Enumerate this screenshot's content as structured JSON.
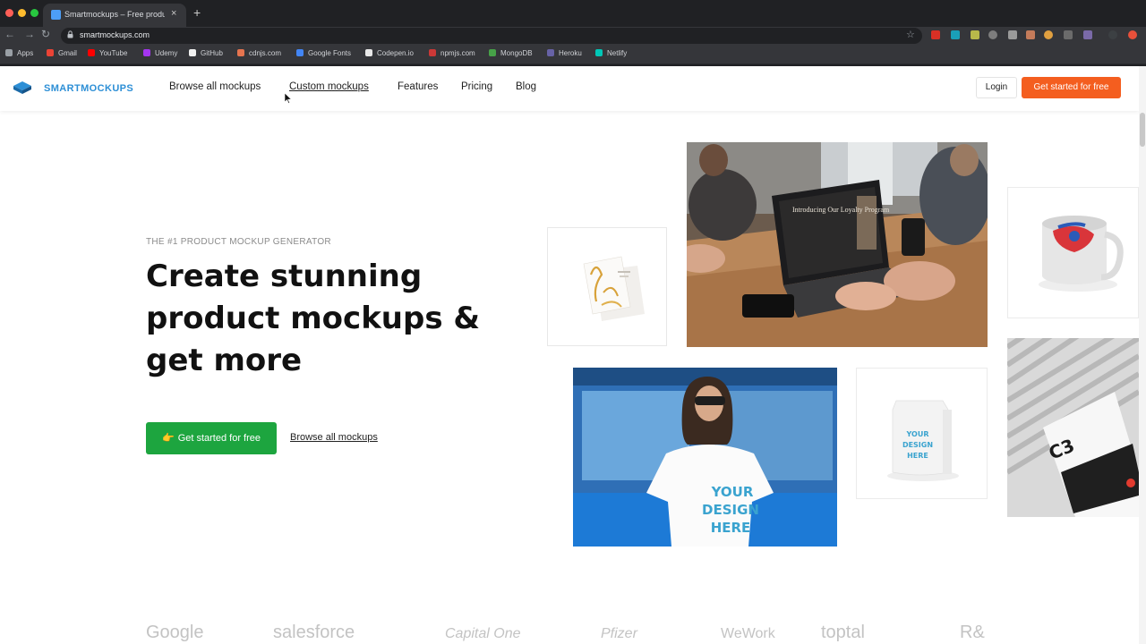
{
  "browser": {
    "tab_title": "Smartmockups – Free product",
    "tab_close": "×",
    "new_tab": "+",
    "back": "←",
    "forward": "→",
    "reload": "↻",
    "url": "smartmockups.com",
    "star": "☆",
    "lock": "🔒",
    "bookmarks": [
      {
        "label": "Apps",
        "color": "#9aa0a6"
      },
      {
        "label": "Gmail",
        "color": "#ea4335"
      },
      {
        "label": "YouTube",
        "color": "#ff0000"
      },
      {
        "label": "Udemy",
        "color": "#a435f0"
      },
      {
        "label": "GitHub",
        "color": "#f0f0f0"
      },
      {
        "label": "cdnjs.com",
        "color": "#e5744f"
      },
      {
        "label": "Google Fonts",
        "color": "#4285f4"
      },
      {
        "label": "Codepen.io",
        "color": "#e8e8e8"
      },
      {
        "label": "npmjs.com",
        "color": "#cb3837"
      },
      {
        "label": "MongoDB",
        "color": "#47a248"
      },
      {
        "label": "Heroku",
        "color": "#6762a6"
      },
      {
        "label": "Netlify",
        "color": "#00c7b7"
      }
    ]
  },
  "site": {
    "logo": "SMARTMOCKUPS",
    "nav": [
      "Browse all mockups",
      "Custom mockups",
      "Features",
      "Pricing",
      "Blog"
    ],
    "login": "Login",
    "cta_header": "Get started for free"
  },
  "hero": {
    "eyebrow": "THE #1 PRODUCT MOCKUP GENERATOR",
    "headline": "Create stunning product mockups & get more",
    "cta_icon": "👉",
    "cta": "Get started for free",
    "browse_link": "Browse all mockups"
  },
  "mockups": {
    "laptop_screen_text": "Introducing Our Loyalty Program",
    "tshirt_text": [
      "YOUR",
      "DESIGN",
      "HERE"
    ],
    "coffee_text": [
      "YOUR",
      "DESIGN",
      "HERE"
    ],
    "magazine_text": "C3"
  },
  "brands": [
    "Google",
    "salesforce",
    "Capital One",
    "Pfizer",
    "WeWork",
    "toptal",
    "R&"
  ],
  "colors": {
    "brand_blue": "#2d8fd6",
    "cta_orange": "#f45e1f",
    "cta_green": "#1da53f"
  }
}
